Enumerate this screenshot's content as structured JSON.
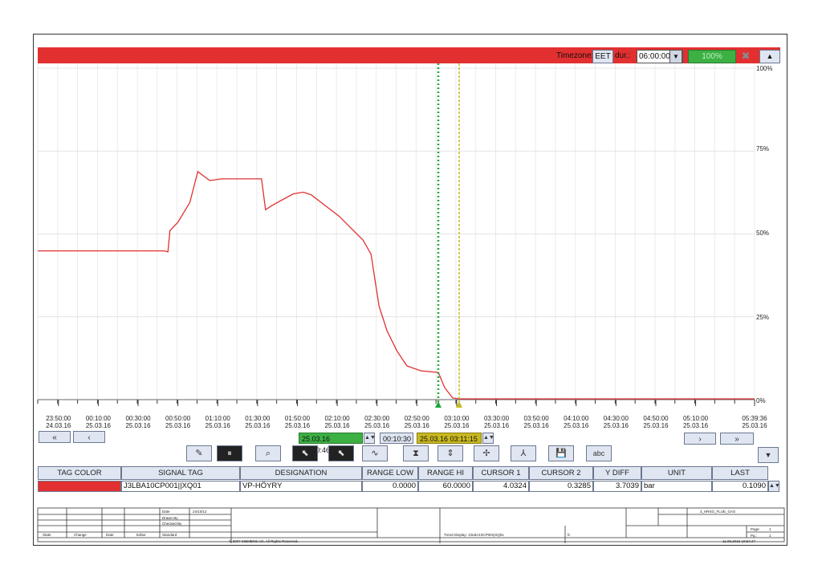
{
  "window": {
    "timezone_label": "Timezone:",
    "timezone_value": "EET",
    "duration_label": "dur.:",
    "duration_value": "06:00:00",
    "zoom_value": "100%"
  },
  "chart_data": {
    "type": "line",
    "y_axis": {
      "ticks": [
        "100%",
        "75%",
        "50%",
        "25%",
        "0%"
      ],
      "ylim": [
        0,
        100
      ]
    },
    "x_ticks": [
      {
        "time": "23:50:00",
        "date": "24.03.16"
      },
      {
        "time": "00:10:00",
        "date": "25.03.16"
      },
      {
        "time": "00:30:00",
        "date": "25.03.16"
      },
      {
        "time": "00:50:00",
        "date": "25.03.16"
      },
      {
        "time": "01:10:00",
        "date": "25.03.16"
      },
      {
        "time": "01:30:00",
        "date": "25.03.16"
      },
      {
        "time": "01:50:00",
        "date": "25.03.16"
      },
      {
        "time": "02:10:00",
        "date": "25.03.16"
      },
      {
        "time": "02:30:00",
        "date": "25.03.16"
      },
      {
        "time": "02:50:00",
        "date": "25.03.16"
      },
      {
        "time": "03:10:00",
        "date": "25.03.16"
      },
      {
        "time": "03:30:00",
        "date": "25.03.16"
      },
      {
        "time": "03:50:00",
        "date": "25.03.16"
      },
      {
        "time": "04:10:00",
        "date": "25.03.16"
      },
      {
        "time": "04:30:00",
        "date": "25.03.16"
      },
      {
        "time": "04:50:00",
        "date": "25.03.16"
      },
      {
        "time": "05:10:00",
        "date": "25.03.16"
      },
      {
        "time": "05:39:36",
        "date": "25.03.16"
      }
    ],
    "series": [
      {
        "color": "#e03030",
        "points": [
          [
            "23:39:36",
            44.9
          ],
          [
            "00:43:00",
            44.9
          ],
          [
            "00:45:00",
            44.6
          ],
          [
            "00:46:00",
            51
          ],
          [
            "00:50:00",
            53.5
          ],
          [
            "00:56:00",
            59.5
          ],
          [
            "01:00:00",
            68.8
          ],
          [
            "01:06:00",
            66.1
          ],
          [
            "01:12:00",
            66.6
          ],
          [
            "01:20:00",
            66.6
          ],
          [
            "01:32:00",
            66.6
          ],
          [
            "01:34:00",
            57.3
          ],
          [
            "01:37:00",
            58.5
          ],
          [
            "01:48:00",
            62.1
          ],
          [
            "01:53:00",
            62.6
          ],
          [
            "01:57:00",
            61.8
          ],
          [
            "02:11:00",
            55.3
          ],
          [
            "02:23:00",
            48.1
          ],
          [
            "02:27:00",
            43.9
          ],
          [
            "02:31:00",
            28.2
          ],
          [
            "02:35:00",
            20.8
          ],
          [
            "02:40:00",
            14.7
          ],
          [
            "02:45:00",
            10.2
          ],
          [
            "02:52:00",
            8.7
          ],
          [
            "03:00:46",
            8.2
          ],
          [
            "03:04:00",
            3.6
          ],
          [
            "03:08:00",
            0.5
          ],
          [
            "03:11:15",
            0.24
          ],
          [
            "03:30:00",
            0.24
          ],
          [
            "05:39:36",
            0.24
          ]
        ]
      }
    ],
    "cursors": [
      {
        "name": "CURSOR 1",
        "time": "03:00:46",
        "color": "#1ea83c"
      },
      {
        "name": "CURSOR 2",
        "time": "03:11:15",
        "color": "#c8b820"
      }
    ]
  },
  "cursor_bar": {
    "cursor1_time": "25.03.16 03:00:46",
    "delta": "00:10:30",
    "cursor2_time": "25.03.16 03:11:15"
  },
  "nav": {
    "left_fast": "«",
    "left": "‹",
    "right": "›",
    "right_fast": "»"
  },
  "toolbar": {
    "text_tool_label": "abc",
    "bar_tool_label": "⏸"
  },
  "table": {
    "headers": [
      "TAG COLOR",
      "SIGNAL TAG",
      "DESIGNATION",
      "RANGE LOW",
      "RANGE HI",
      "CURSOR 1",
      "CURSOR 2",
      "Y DIFF",
      "UNIT",
      "LAST"
    ],
    "rows": [
      {
        "tag_color": "#e23030",
        "signal_tag": "J3LBA10CP001||XQ01",
        "designation": "VP-HÖYRY",
        "range_low": "0.0000",
        "range_hi": "60.0000",
        "cursor1": "4.0324",
        "cursor2": "0.3285",
        "y_diff": "3.7039",
        "unit": "bar",
        "last": "0.1090"
      }
    ]
  },
  "footer": {
    "date_label": "Date",
    "date_value": "24/10/12",
    "drawn_by": "Drawn By",
    "checked_by": "Checked By",
    "standard": "Standard",
    "state": "State",
    "change": "Change",
    "date_col": "Date",
    "editor": "Editor",
    "copyright": "© 2007 SIEMENS AG. All Rights Reserved.",
    "trend_display": "Trend Display: J3LBA10CP001|XQ01",
    "fc_field": "fc",
    "project": "3_HRSG_FLUE_GAS",
    "page_label": "Page:",
    "page_value": "1",
    "pg_label": "Pg.:",
    "pg_value": "1",
    "timestamp": "11.08.2016 19:54:47"
  }
}
